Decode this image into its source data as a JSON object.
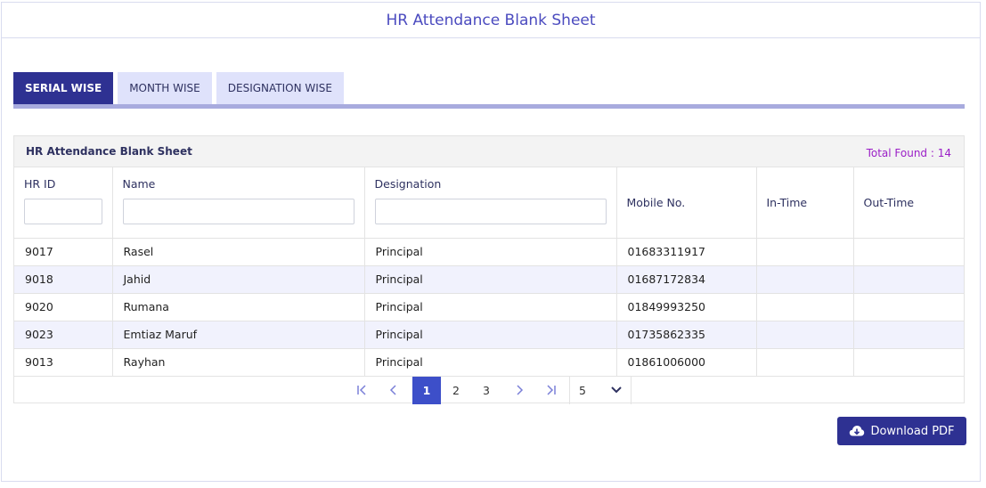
{
  "header": {
    "title": "HR Attendance Blank Sheet"
  },
  "tabs": [
    {
      "label": "SERIAL WISE",
      "active": true
    },
    {
      "label": "MONTH WISE",
      "active": false
    },
    {
      "label": "DESIGNATION WISE",
      "active": false
    }
  ],
  "panel": {
    "title": "HR Attendance Blank Sheet",
    "total": "Total Found : 14"
  },
  "table": {
    "columns": [
      "HR ID",
      "Name",
      "Designation",
      "Mobile No.",
      "In-Time",
      "Out-Time"
    ],
    "rows": [
      [
        "9017",
        "Rasel",
        "Principal",
        "01683311917",
        "",
        ""
      ],
      [
        "9018",
        "Jahid",
        "Principal",
        "01687172834",
        "",
        ""
      ],
      [
        "9020",
        "Rumana",
        "Principal",
        "01849993250",
        "",
        ""
      ],
      [
        "9023",
        "Emtiaz Maruf",
        "Principal",
        "01735862335",
        "",
        ""
      ],
      [
        "9013",
        "Rayhan",
        "Principal",
        "01861006000",
        "",
        ""
      ]
    ]
  },
  "pagination": {
    "first_icon": "first-page-icon",
    "prev_icon": "chevron-left-icon",
    "pages": [
      "1",
      "2",
      "3"
    ],
    "current_page": "1",
    "next_icon": "chevron-right-icon",
    "last_icon": "last-page-icon",
    "page_size": "5",
    "page_size_icon": "chevron-down-icon"
  },
  "download": {
    "label": "Download PDF",
    "icon": "cloud-download-icon"
  },
  "colors": {
    "primary": "#2e3192",
    "accent": "#3d4fc9",
    "tab_inactive": "#dfe2fb",
    "count_text": "#9b1fc7",
    "title_text": "#4b4bbf"
  }
}
